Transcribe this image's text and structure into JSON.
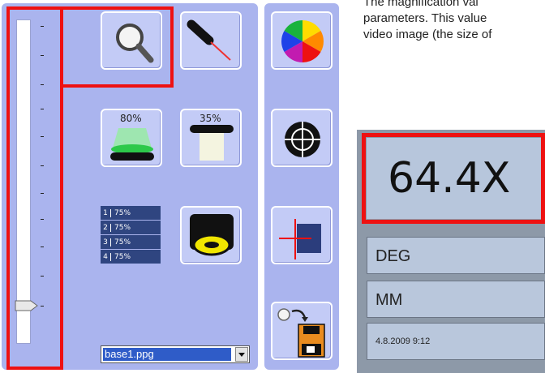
{
  "toolbar": {
    "backlight_percent": "80%",
    "coaxial_percent": "35%",
    "lamp_rows": [
      {
        "num": "1",
        "val": "75%"
      },
      {
        "num": "2",
        "val": "75%"
      },
      {
        "num": "3",
        "val": "75%"
      },
      {
        "num": "4",
        "val": "75%"
      }
    ],
    "file_name": "base1.ppg",
    "icons": {
      "zoom": "magnifier-icon",
      "laser": "laser-pointer-icon",
      "backlight": "backlight-icon",
      "coaxial": "coaxial-light-icon",
      "ring": "ring-light-icon",
      "color": "color-wheel-icon",
      "crosshair": "crosshair-icon",
      "edge": "edge-probe-icon",
      "save": "save-program-icon"
    }
  },
  "description": {
    "line1": "The magnification val",
    "line2": "parameters. This value",
    "line3": "video image (the size of"
  },
  "status": {
    "magnification": "64.4X",
    "angle_unit": "DEG",
    "length_unit": "MM",
    "datetime": "4.8.2009 9:12"
  },
  "colors": {
    "panel": "#aab4ee",
    "highlight": "#ee1111",
    "selection": "#2f5cc8"
  }
}
